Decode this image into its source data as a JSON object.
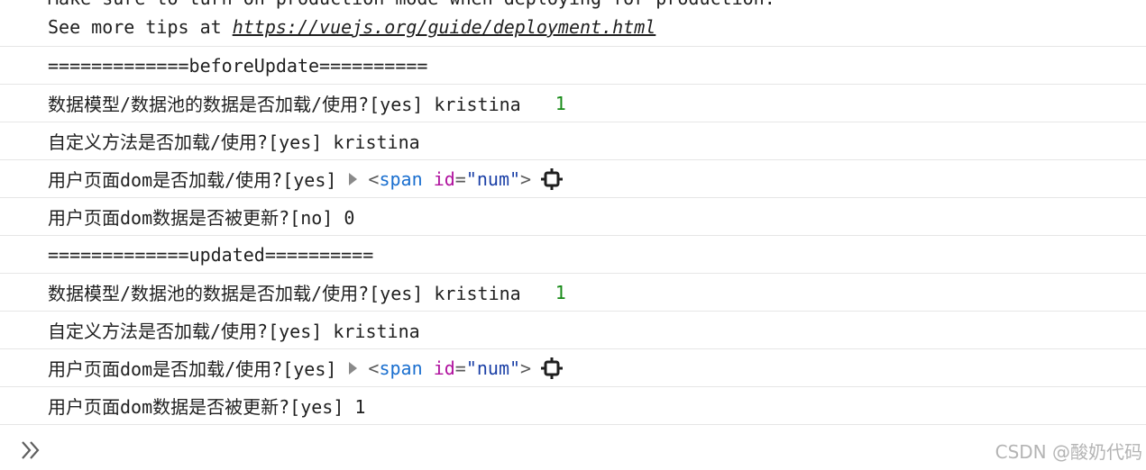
{
  "warning": {
    "line1": "Make sure to turn on production mode when deploying for production.",
    "line2_prefix": "See more tips at ",
    "line2_link": "https://vuejs.org/guide/deployment.html"
  },
  "logs": [
    {
      "text": "=============beforeUpdate=========="
    },
    {
      "text": "数据模型/数据池的数据是否加载/使用?[yes] kristina",
      "count": "1"
    },
    {
      "text": "自定义方法是否加载/使用?[yes] kristina"
    },
    {
      "text": "用户页面dom是否加载/使用?[yes]",
      "tag_open": "<",
      "tag_name": "span",
      "attr_name": "id",
      "attr_eq": "=",
      "attr_value": "\"num\"",
      "tag_close": ">"
    },
    {
      "text": "用户页面dom数据是否被更新?[no] 0"
    },
    {
      "text": "=============updated=========="
    },
    {
      "text": "数据模型/数据池的数据是否加载/使用?[yes] kristina",
      "count": "1"
    },
    {
      "text": "自定义方法是否加载/使用?[yes] kristina"
    },
    {
      "text": "用户页面dom是否加载/使用?[yes]",
      "tag_open": "<",
      "tag_name": "span",
      "attr_name": "id",
      "attr_eq": "=",
      "attr_value": "\"num\"",
      "tag_close": ">"
    },
    {
      "text": "用户页面dom数据是否被更新?[yes] 1"
    }
  ],
  "icons": {
    "expand": "expand-triangle-icon",
    "inspect": "inspect-element-icon",
    "prompt": "double-chevron-right-icon"
  },
  "colors": {
    "count_green": "#168a16",
    "tag_blue": "#1a6fcf",
    "attr_magenta": "#b0119e",
    "value_blue": "#1a3fa6"
  },
  "watermark": "CSDN @酸奶代码"
}
